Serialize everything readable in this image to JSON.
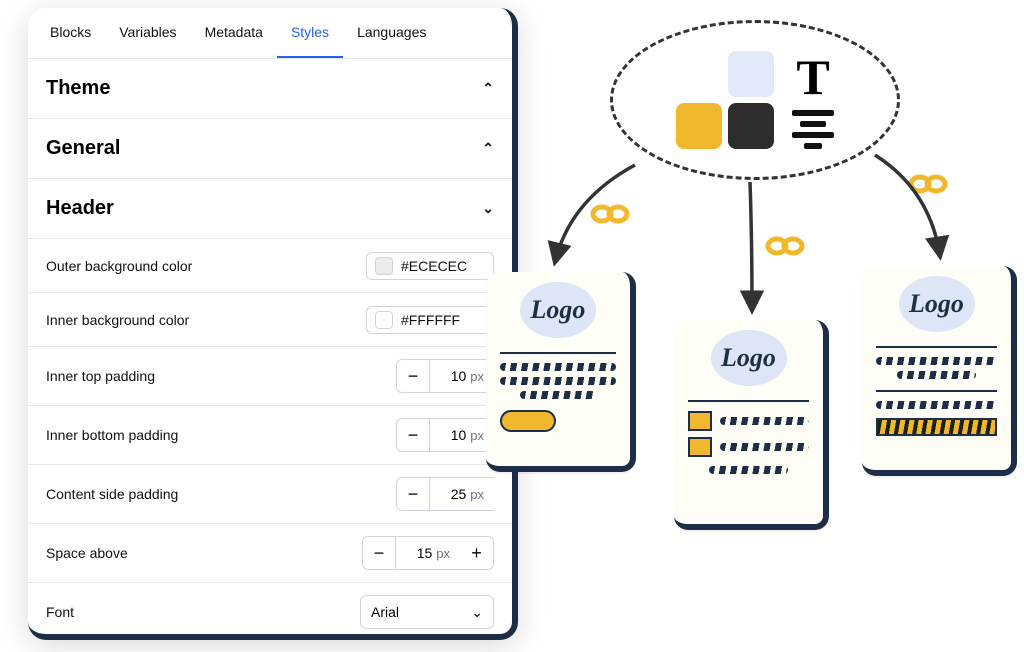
{
  "tabs": [
    "Blocks",
    "Variables",
    "Metadata",
    "Styles",
    "Languages"
  ],
  "active_tab": "Styles",
  "sections": {
    "theme": {
      "title": "Theme",
      "expanded": false
    },
    "general": {
      "title": "General",
      "expanded": false
    },
    "header": {
      "title": "Header",
      "expanded": true
    }
  },
  "header_rows": {
    "outer_bg": {
      "label": "Outer background color",
      "value": "#ECECEC",
      "swatch": "#ECECEC"
    },
    "inner_bg": {
      "label": "Inner background color",
      "value": "#FFFFFF",
      "swatch": "#FFFFFF"
    },
    "inner_top": {
      "label": "Inner top padding",
      "value": "10",
      "unit": "px"
    },
    "inner_bottom": {
      "label": "Inner bottom padding",
      "value": "10",
      "unit": "px"
    },
    "side_pad": {
      "label": "Content side padding",
      "value": "25",
      "unit": "px"
    },
    "space_above": {
      "label": "Space above",
      "value": "15",
      "unit": "px"
    },
    "font": {
      "label": "Font",
      "value": "Arial"
    }
  },
  "logo_text": "Logo",
  "colors": {
    "accent": "#f1b82e",
    "frame": "#1c2f46",
    "active_tab": "#2563eb"
  }
}
